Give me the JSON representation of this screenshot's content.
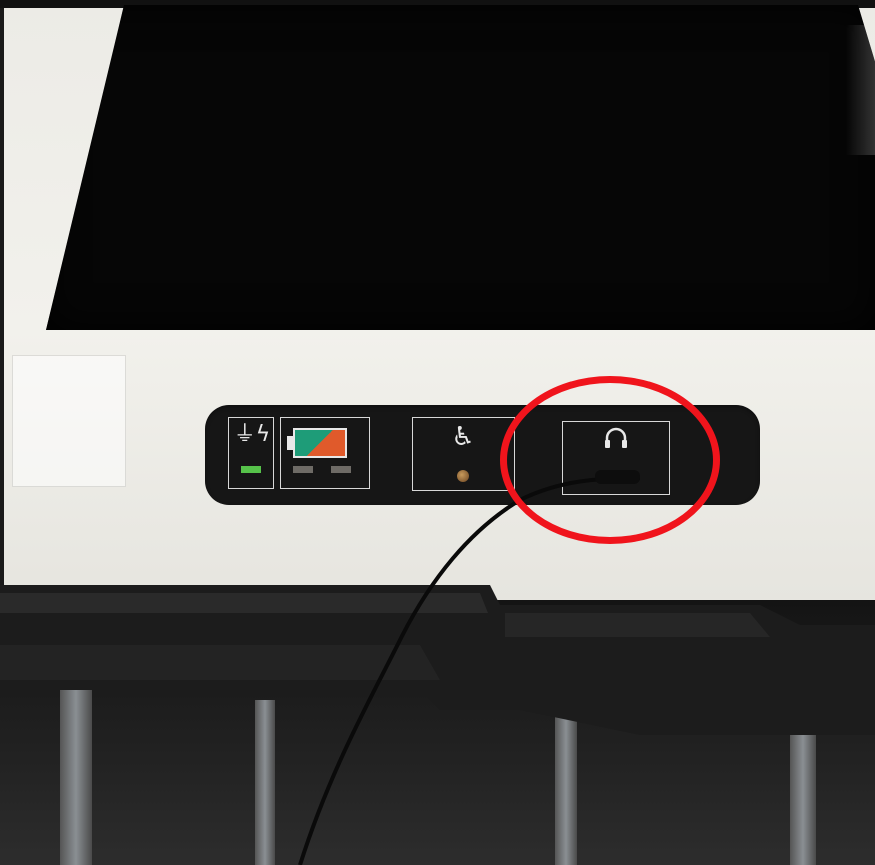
{
  "scene": {
    "description_free": true,
    "annotation_color": "#f0141c",
    "icons": [
      "power-plug-icon",
      "battery-icon",
      "wheelchair-icon",
      "headphones-icon"
    ],
    "panel": {
      "power_led_color": "#56c24a",
      "battery_colors": [
        "#1e9c78",
        "#e05a2b"
      ],
      "power_symbol": "⏻ϟ",
      "accessibility_symbol": "♿",
      "headphone_symbol": "🎧"
    }
  }
}
